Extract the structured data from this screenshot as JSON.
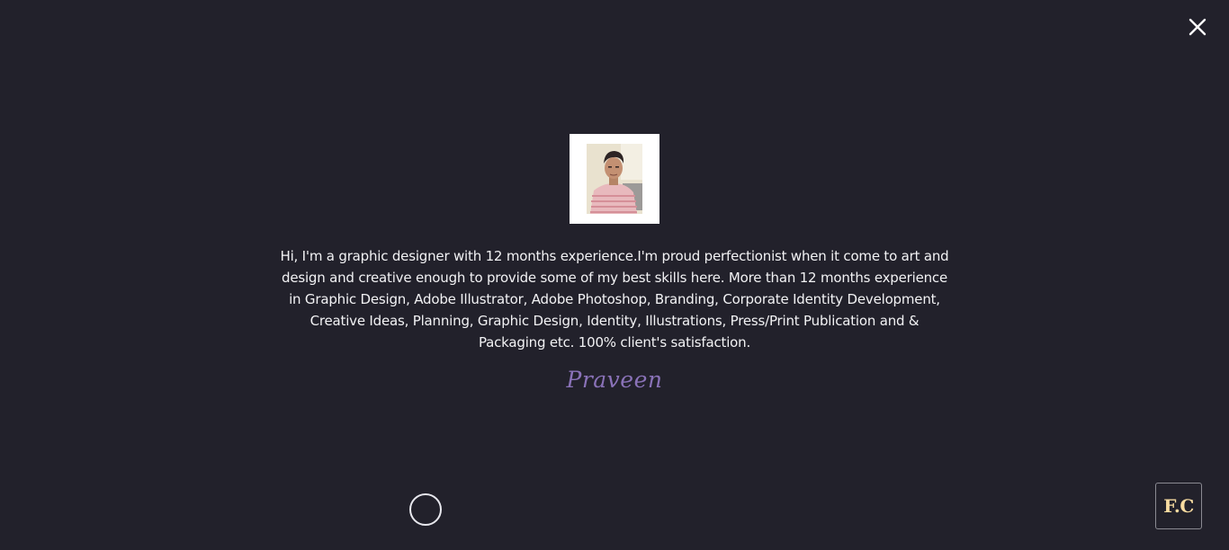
{
  "close": {
    "icon": "close-icon"
  },
  "profile": {
    "photo_icon": "portrait-photo",
    "bio": "Hi, I'm a graphic designer with 12 months experience.I'm proud perfectionist when it come to art and design and creative enough to provide some of my best skills here. More than 12 months experience in Graphic Design, Adobe Illustrator, Adobe Photoshop, Branding, Corporate Identity Development, Creative Ideas, Planning, Graphic Design, Identity, Illustrations, Press/Print Publication and & Packaging etc. 100% client's satisfaction.",
    "signature": "Praveen"
  },
  "logo": {
    "text": "F.C"
  },
  "colors": {
    "background": "#22212b",
    "signature": "#8a72b8",
    "logo_text": "#f7dba0"
  }
}
